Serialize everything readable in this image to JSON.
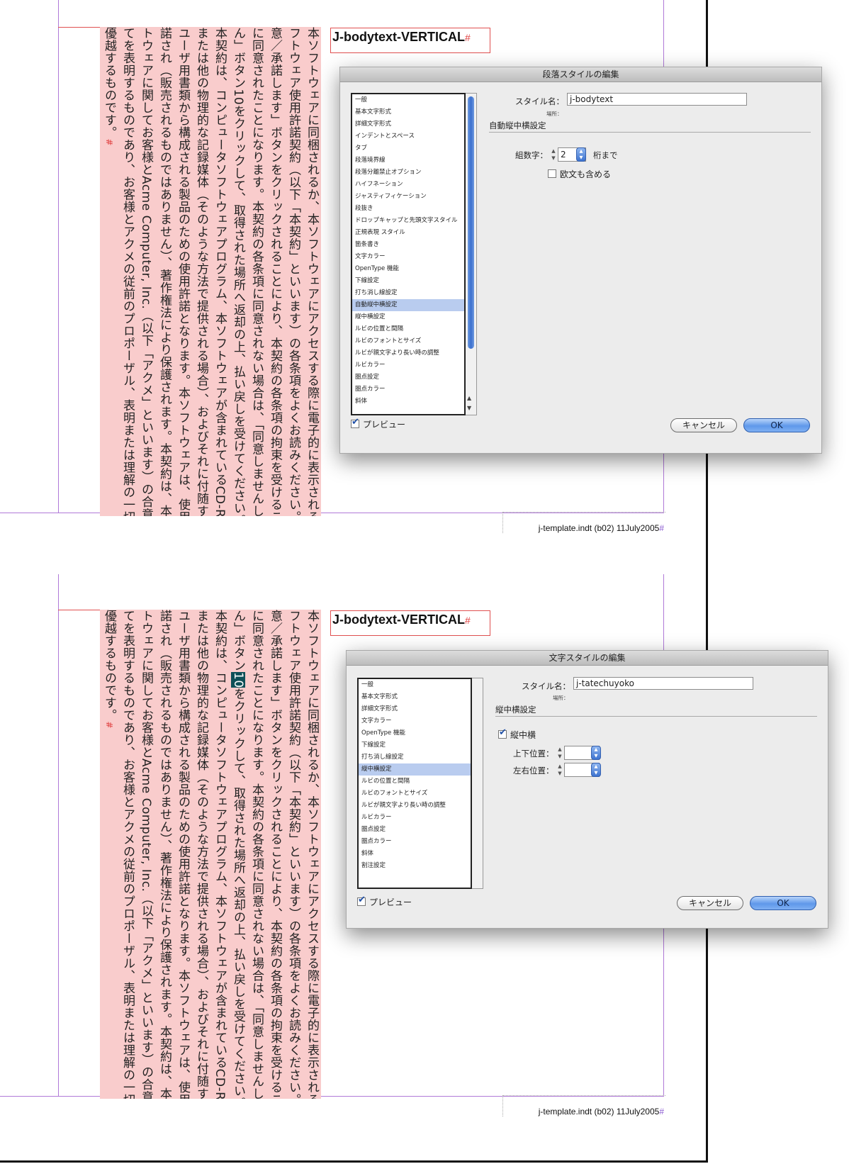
{
  "body_text": {
    "columns": [
      "本ソフトウェアに同梱されるか、本ソフトウェアにアクセスする際に電子的に表示されるソ",
      "フトウェア使用許諾契約（以下「本契約」といいます）の各条項をよくお読みください。「同",
      "意／承諾します」ボタンをクリックされることにより、本契約の各条項の拘束を受けること",
      "に同意されたことになります。本契約の各条項に同意されない場合は、「同意しませんしませ",
      "ん」ボタンを10クリックして、取得された場所へ返却の上、払い戻しを受けてください。",
      "本契約は、コンピュータソフトウェアプログラム、本ソフトウェアが含まれているCD-ROM",
      "または他の物理的な記録媒体（そのような方法で提供される場合）、およびそれに付随する本",
      "ユーザ用書類から構成される製品のための使用許諾となります。本ソフトウェアは、使用許",
      "諾され（販売されるものではありません）、著作権法により保護されます。本契約は、本ソフ",
      "トウェアに関してお客様とAcme Computer, Inc.（以下「アクメ」といいます）の合意のすべ",
      "てを表明するものであり、お客様とアクメの従前のプロポーザル、表明または理解の一切に",
      "優越するものです。"
    ],
    "col5_pre": "ん」ボタン",
    "col5_num": "10",
    "col5_post": "をクリックして、取得された場所へ返却の上、払い戻しを受けてください。",
    "para_mark": "#",
    "end_mark": "#"
  },
  "top": {
    "style_label": "J-bodytext-VERTICAL",
    "style_mark": "#",
    "footer": "j-template.indt (b02) 11July2005",
    "footer_mark": "#",
    "dialog": {
      "title": "段落スタイルの編集",
      "categories": [
        "一般",
        "基本文字形式",
        "詳細文字形式",
        "インデントとスペース",
        "タブ",
        "段落境界線",
        "段落分離禁止オプション",
        "ハイフネーション",
        "ジャスティフィケーション",
        "段抜き",
        "ドロップキャップと先頭文字スタイル",
        "正規表現 スタイル",
        "箇条書き",
        "文字カラー",
        "OpenType 機能",
        "下線設定",
        "打ち消し線設定",
        "自動縦中横設定",
        "縦中横設定",
        "ルビの位置と間隔",
        "ルビのフォントとサイズ",
        "ルビが親文字より長い時の調整",
        "ルビカラー",
        "圏点設定",
        "圏点カラー",
        "斜体"
      ],
      "selected_index": 17,
      "style_name_label": "スタイル名：",
      "style_name_value": "j-bodytext",
      "location_label": "場所：",
      "section_title": "自動縦中横設定",
      "digits_label": "組数字：",
      "digits_value": "2",
      "digits_suffix": "桁まで",
      "include_roman_label": "欧文も含める",
      "include_roman_checked": false,
      "preview_label": "プレビュー",
      "preview_checked": true,
      "cancel_label": "キャンセル",
      "ok_label": "OK"
    }
  },
  "bottom": {
    "style_label": "J-bodytext-VERTICAL",
    "style_mark": "#",
    "footer": "j-template.indt (b02) 11July2005",
    "footer_mark": "#",
    "dialog": {
      "title": "文字スタイルの編集",
      "categories": [
        "一般",
        "基本文字形式",
        "詳細文字形式",
        "文字カラー",
        "OpenType 機能",
        "下線設定",
        "打ち消し線設定",
        "縦中横設定",
        "ルビの位置と間隔",
        "ルビのフォントとサイズ",
        "ルビが親文字より長い時の調整",
        "ルビカラー",
        "圏点設定",
        "圏点カラー",
        "斜体",
        "割注設定"
      ],
      "selected_index": 7,
      "style_name_label": "スタイル名：",
      "style_name_value": "j-tatechuyoko",
      "location_label": "場所：",
      "section_title": "縦中横設定",
      "tcy_label": "縦中横",
      "tcy_checked": true,
      "vertical_pos_label": "上下位置：",
      "horizontal_pos_label": "左右位置：",
      "vertical_pos_value": "",
      "horizontal_pos_value": "",
      "preview_label": "プレビュー",
      "preview_checked": true,
      "cancel_label": "キャンセル",
      "ok_label": "OK"
    }
  }
}
